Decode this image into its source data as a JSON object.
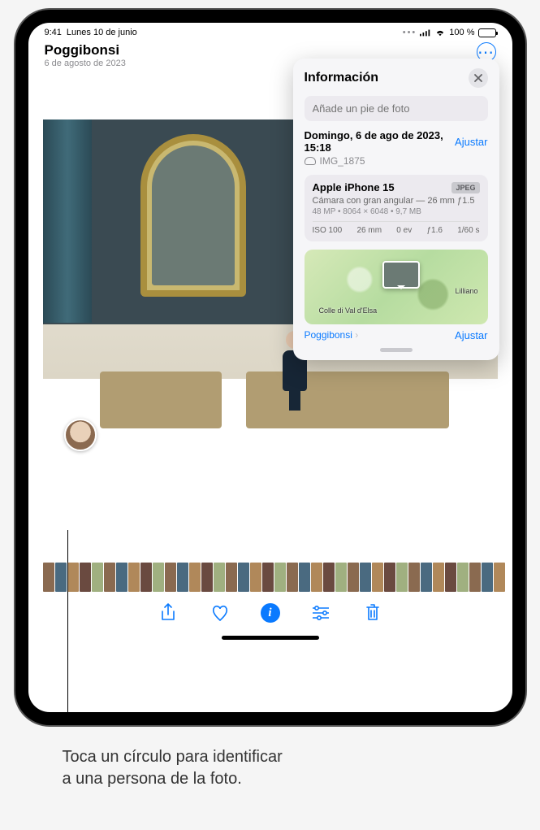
{
  "statusbar": {
    "time": "9:41",
    "date": "Lunes 10 de junio",
    "battery_pct": "100 %"
  },
  "header": {
    "location": "Poggibonsi",
    "subtitle": "6 de agosto de 2023"
  },
  "info_panel": {
    "title": "Información",
    "caption_placeholder": "Añade un pie de foto",
    "datetime": "Domingo, 6 de ago de 2023, 15:18",
    "adjust_label": "Ajustar",
    "filename": "IMG_1875",
    "camera": {
      "device": "Apple iPhone 15",
      "format_badge": "JPEG",
      "lens": "Cámara con gran angular — 26 mm ƒ1.5",
      "megapixels": "48 MP",
      "resolution": "8064 × 6048",
      "filesize": "9,7 MB",
      "iso": "ISO 100",
      "focal": "26 mm",
      "ev": "0 ev",
      "aperture": "ƒ1.6",
      "shutter": "1/60 s"
    },
    "map": {
      "label_1": "Colle di Val d'Elsa",
      "label_2": "Lilliano",
      "location_link": "Poggibonsi",
      "adjust_label": "Ajustar"
    }
  },
  "callout": {
    "line1": "Toca un círculo para identificar",
    "line2": "a una persona de la foto."
  }
}
